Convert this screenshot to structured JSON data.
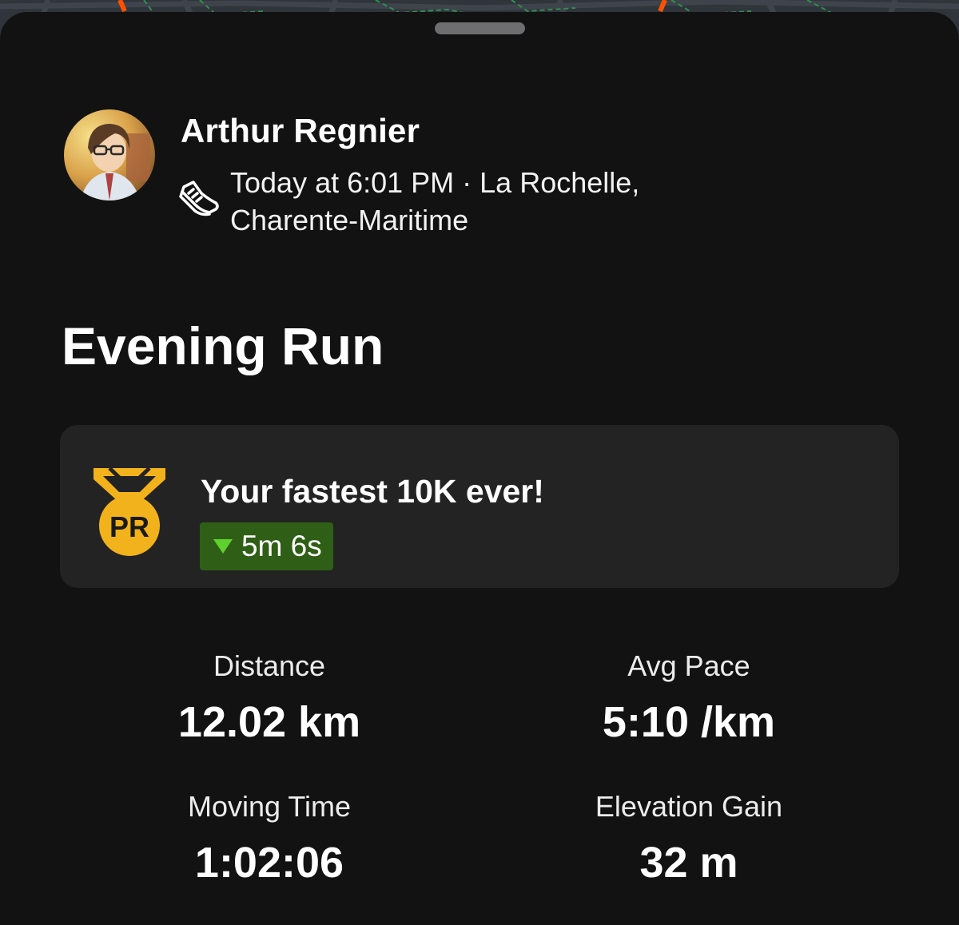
{
  "athlete": {
    "name": "Arthur Regnier",
    "avatar_icon": "user-avatar",
    "activity_type_icon": "running-shoe-icon",
    "meta_line": "Today at 6:01 PM · La Rochelle, Charente-Maritime"
  },
  "activity": {
    "title": "Evening Run"
  },
  "achievement": {
    "medal_icon": "pr-medal-icon",
    "medal_text": "PR",
    "headline": "Your fastest 10K ever!",
    "improvement": "5m 6s",
    "improvement_direction": "down",
    "colors": {
      "medal": "#f2b21b",
      "badge_bg": "#2f5e17",
      "badge_arrow": "#5fd12f"
    }
  },
  "stats": [
    {
      "label": "Distance",
      "value": "12.02 km"
    },
    {
      "label": "Avg Pace",
      "value": "5:10 /km"
    },
    {
      "label": "Moving Time",
      "value": "1:02:06"
    },
    {
      "label": "Elevation Gain",
      "value": "32 m"
    }
  ],
  "theme": {
    "sheet_bg": "#121212",
    "card_bg": "#232323",
    "route_color": "#fc5200"
  }
}
